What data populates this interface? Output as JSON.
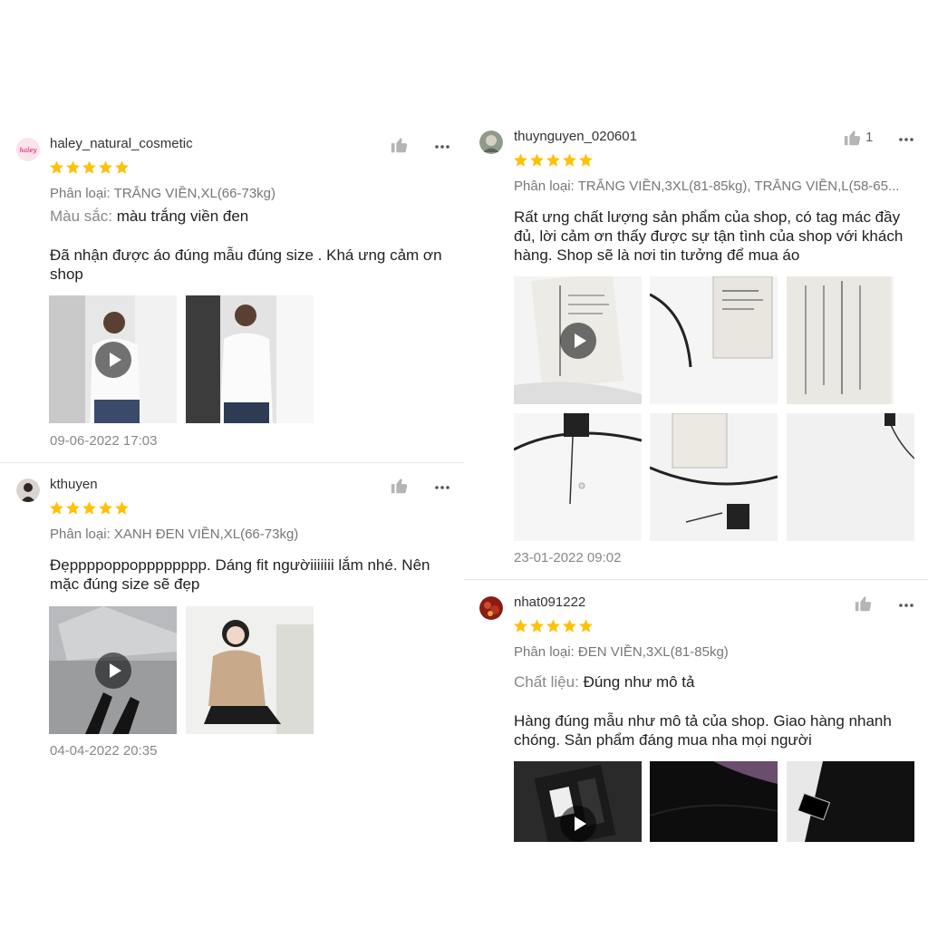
{
  "reviews": [
    {
      "username": "haley_natural_cosmetic",
      "rating": 5,
      "variation_label": "Phân loại:",
      "variation_value": "TRẮNG VIỀN,XL(66-73kg)",
      "attr_key": "Màu sắc:",
      "attr_value": "màu trắng viền đen",
      "comment": "Đã nhận được áo đúng mẫu đúng size . Khá ưng cảm ơn shop",
      "media_count": 2,
      "date": "09-06-2022 17:03"
    },
    {
      "username": "kthuyen",
      "rating": 5,
      "variation_label": "Phân loại:",
      "variation_value": "XANH ĐEN VIỀN,XL(66-73kg)",
      "comment": "Đẹppppoppopppppppp. Dáng fit ngườiiiiiii lắm nhé. Nên mặc đúng size sẽ đẹp",
      "media_count": 2,
      "date": "04-04-2022 20:35"
    },
    {
      "username": "thuynguyen_020601",
      "rating": 5,
      "like_count": "1",
      "variation_label": "Phân loại:",
      "variation_value": "TRẮNG VIỀN,3XL(81-85kg), TRẮNG VIỀN,L(58-65...",
      "comment": "Rất ưng chất lượng sản phẩm của shop, có tag mác đầy đủ, lời cảm ơn thấy được sự tận tình của shop với khách hàng. Shop sẽ là nơi tin tưởng để mua áo",
      "media_count": 6,
      "date": "23-01-2022 09:02"
    },
    {
      "username": "nhat091222",
      "rating": 5,
      "variation_label": "Phân loại:",
      "variation_value": "ĐEN VIỀN,3XL(81-85kg)",
      "attr_key": "Chất liệu:",
      "attr_value": "Đúng như mô tả",
      "comment": "Hàng đúng mẫu như mô tả của shop. Giao hàng nhanh chóng. Sản phẩm đáng mua nha mọi người",
      "media_count": 3
    }
  ],
  "colors": {
    "star": "#ffc107",
    "icon": "#b5b5b5",
    "meta_text": "#777777"
  },
  "icons": {
    "like": "thumbs-up-icon",
    "more": "more-dots-icon",
    "star": "star-icon",
    "play": "play-icon"
  }
}
